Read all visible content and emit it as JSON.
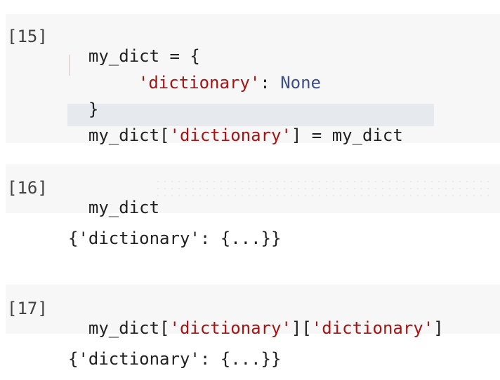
{
  "cells": [
    {
      "prompt": "[15]",
      "code": {
        "line1_var": "my_dict",
        "line1_op": " = {",
        "line2_key": "'dictionary'",
        "line2_colon": ": ",
        "line2_val": "None",
        "line3": "}",
        "line4_var": "my_dict[",
        "line4_key": "'dictionary'",
        "line4_rest": "] = my_dict"
      }
    },
    {
      "prompt": "[16]",
      "code": "my_dict",
      "output": "{'dictionary': {...}}"
    },
    {
      "prompt": "[17]",
      "code": {
        "var": "my_dict[",
        "key1": "'dictionary'",
        "mid": "][",
        "key2": "'dictionary'",
        "end": "]"
      },
      "output": "{'dictionary': {...}}"
    }
  ],
  "colors": {
    "string": "#a31515",
    "keyword": "#3c4f86",
    "cell_bg": "#f7f7f7",
    "highlight": "#e6e9ee"
  }
}
